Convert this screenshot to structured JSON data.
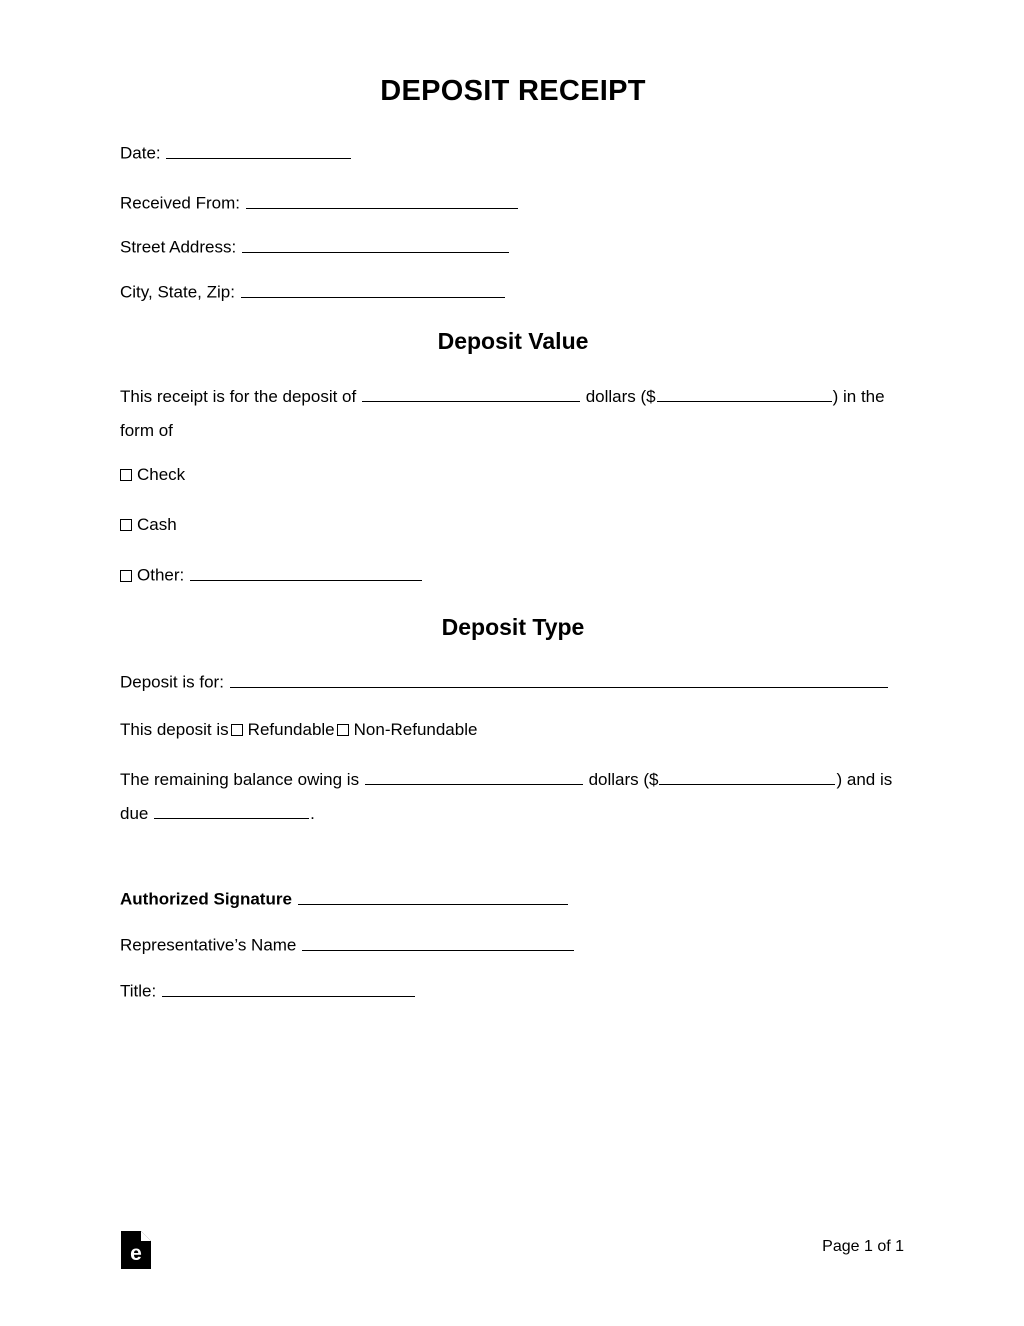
{
  "document": {
    "title": "DEPOSIT RECEIPT"
  },
  "header_fields": {
    "date_label": "Date:",
    "received_from_label": "Received From:",
    "street_address_label": "Street Address:",
    "city_state_zip_label": "City, State, Zip:"
  },
  "deposit_value": {
    "heading": "Deposit Value",
    "sentence_part1": "This receipt is for the deposit of",
    "sentence_part2": "dollars ($",
    "sentence_part3": ") in the form of",
    "options": [
      {
        "label": "Check"
      },
      {
        "label": "Cash"
      },
      {
        "label": "Other:"
      }
    ]
  },
  "deposit_type": {
    "heading": "Deposit Type",
    "deposit_is_for_label": "Deposit is for:",
    "refundable_prefix": "This deposit is",
    "refundable_label": "Refundable",
    "non_refundable_label": "Non-Refundable",
    "balance_part1": "The remaining balance owing is",
    "balance_part2": "dollars ($",
    "balance_part3": ")",
    "balance_part4": "and is due",
    "balance_part5": "."
  },
  "signature_block": {
    "authorized_signature_label": "Authorized Signature",
    "representative_name_label": "Representative’s Name",
    "title_label": "Title:"
  },
  "footer": {
    "logo_letter": "e",
    "page_indicator": "Page 1 of 1"
  }
}
